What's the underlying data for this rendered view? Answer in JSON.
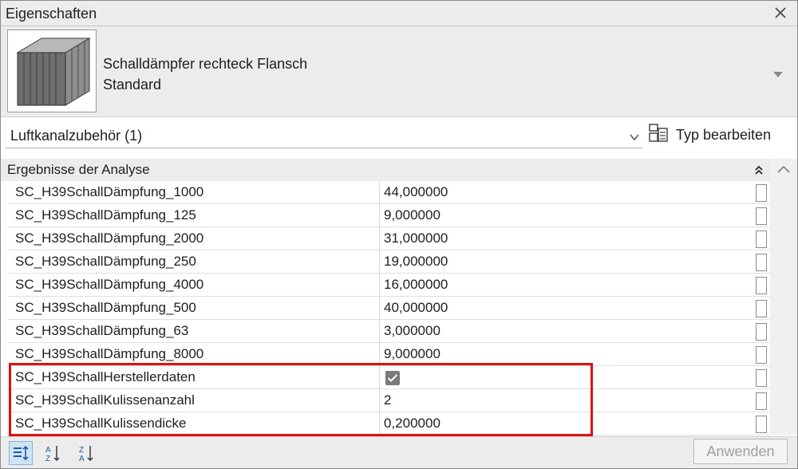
{
  "window": {
    "title": "Eigenschaften"
  },
  "type_selector": {
    "family": "Schalldämpfer rechteck Flansch",
    "type": "Standard",
    "thumbnail_icon": "silencer-3d-thumbnail"
  },
  "filter": {
    "label": "Luftkanalzubehör (1)",
    "edit_type_label": "Typ bearbeiten"
  },
  "group": {
    "label": "Ergebnisse der Analyse"
  },
  "properties": [
    {
      "name": "SC_H39SchallDämpfung_1000",
      "value": "44,000000"
    },
    {
      "name": "SC_H39SchallDämpfung_125",
      "value": "9,000000"
    },
    {
      "name": "SC_H39SchallDämpfung_2000",
      "value": "31,000000"
    },
    {
      "name": "SC_H39SchallDämpfung_250",
      "value": "19,000000"
    },
    {
      "name": "SC_H39SchallDämpfung_4000",
      "value": "16,000000"
    },
    {
      "name": "SC_H39SchallDämpfung_500",
      "value": "40,000000"
    },
    {
      "name": "SC_H39SchallDämpfung_63",
      "value": "3,000000"
    },
    {
      "name": "SC_H39SchallDämpfung_8000",
      "value": "9,000000"
    },
    {
      "name": "SC_H39SchallHerstellerdaten",
      "value": "",
      "checkbox": true,
      "checked": true
    },
    {
      "name": "SC_H39SchallKulissenanzahl",
      "value": "2"
    },
    {
      "name": "SC_H39SchallKulissendicke",
      "value": "0,200000"
    }
  ],
  "footer": {
    "apply_label": "Anwenden"
  },
  "colors": {
    "highlight": "#e01010",
    "panel_bg": "#ececec",
    "accent": "#1a5ea8"
  }
}
